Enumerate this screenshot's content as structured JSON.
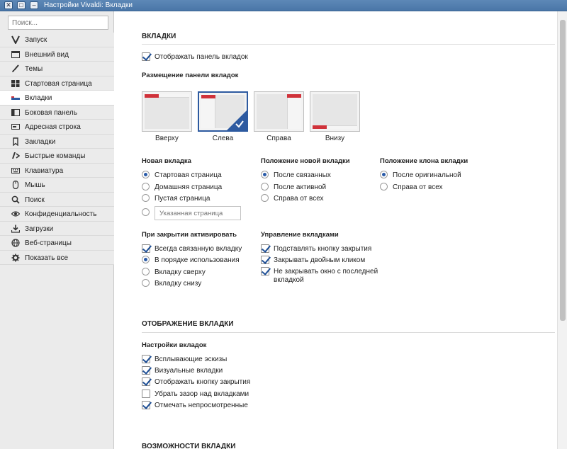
{
  "window": {
    "title": "Настройки Vivaldi: Вкладки"
  },
  "sidebar": {
    "search_placeholder": "Поиск...",
    "items": [
      {
        "label": "Запуск",
        "icon": "vivaldi-icon"
      },
      {
        "label": "Внешний вид",
        "icon": "window-icon"
      },
      {
        "label": "Темы",
        "icon": "brush-icon"
      },
      {
        "label": "Стартовая страница",
        "icon": "grid-icon"
      },
      {
        "label": "Вкладки",
        "icon": "tabs-icon",
        "active": true
      },
      {
        "label": "Боковая панель",
        "icon": "panel-icon"
      },
      {
        "label": "Адресная строка",
        "icon": "addressbar-icon"
      },
      {
        "label": "Закладки",
        "icon": "bookmark-icon"
      },
      {
        "label": "Быстрые команды",
        "icon": "quick-commands-icon"
      },
      {
        "label": "Клавиатура",
        "icon": "keyboard-icon"
      },
      {
        "label": "Мышь",
        "icon": "mouse-icon"
      },
      {
        "label": "Поиск",
        "icon": "search-icon"
      },
      {
        "label": "Конфиденциальность",
        "icon": "eye-icon"
      },
      {
        "label": "Загрузки",
        "icon": "download-icon"
      },
      {
        "label": "Веб-страницы",
        "icon": "globe-icon"
      },
      {
        "label": "Показать все",
        "icon": "gear-icon"
      }
    ]
  },
  "tabs_section": {
    "title": "ВКЛАДКИ",
    "show_tab_bar": {
      "label": "Отображать панель вкладок",
      "checked": true
    },
    "placement": {
      "title": "Размещение панели вкладок",
      "options": [
        {
          "label": "Вверху",
          "selected": false
        },
        {
          "label": "Слева",
          "selected": true
        },
        {
          "label": "Справа",
          "selected": false
        },
        {
          "label": "Внизу",
          "selected": false
        }
      ]
    },
    "new_tab": {
      "title": "Новая вкладка",
      "options": [
        {
          "label": "Стартовая страница",
          "selected": true
        },
        {
          "label": "Домашняя страница",
          "selected": false
        },
        {
          "label": "Пустая страница",
          "selected": false
        },
        {
          "label": "",
          "selected": false
        }
      ],
      "custom_placeholder": "Указанная страница"
    },
    "new_tab_position": {
      "title": "Положение новой вкладки",
      "options": [
        {
          "label": "После связанных",
          "selected": true
        },
        {
          "label": "После активной",
          "selected": false
        },
        {
          "label": "Справа от всех",
          "selected": false
        }
      ]
    },
    "clone_position": {
      "title": "Положение клона вкладки",
      "options": [
        {
          "label": "После оригинальной",
          "selected": true
        },
        {
          "label": "Справа от всех",
          "selected": false
        }
      ]
    },
    "on_close": {
      "title": "При закрытии активировать",
      "options": [
        {
          "label": "Всегда связанную вкладку",
          "type": "checkbox",
          "checked": true
        },
        {
          "label": "В порядке использования",
          "type": "radio",
          "checked": true
        },
        {
          "label": "Вкладку сверху",
          "type": "radio",
          "checked": false
        },
        {
          "label": "Вкладку снизу",
          "type": "radio",
          "checked": false
        }
      ]
    },
    "tab_management": {
      "title": "Управление вкладками",
      "options": [
        {
          "label": "Подставлять кнопку закрытия",
          "checked": true
        },
        {
          "label": "Закрывать двойным кликом",
          "checked": true
        },
        {
          "label": "Не закрывать окно с последней вкладкой",
          "checked": true
        }
      ]
    }
  },
  "tab_display_section": {
    "title": "ОТОБРАЖЕНИЕ ВКЛАДКИ",
    "settings": {
      "title": "Настройки вкладок",
      "options": [
        {
          "label": "Всплывающие эскизы",
          "checked": true
        },
        {
          "label": "Визуальные вкладки",
          "checked": true
        },
        {
          "label": "Отображать кнопку закрытия",
          "checked": true
        },
        {
          "label": "Убрать зазор над вкладками",
          "checked": false
        },
        {
          "label": "Отмечать непросмотренные",
          "checked": true
        }
      ]
    }
  },
  "features_section": {
    "title": "ВОЗМОЖНОСТИ ВКЛАДКИ"
  },
  "colors": {
    "accent": "#2d5aa0",
    "tab_red": "#d0323a"
  }
}
